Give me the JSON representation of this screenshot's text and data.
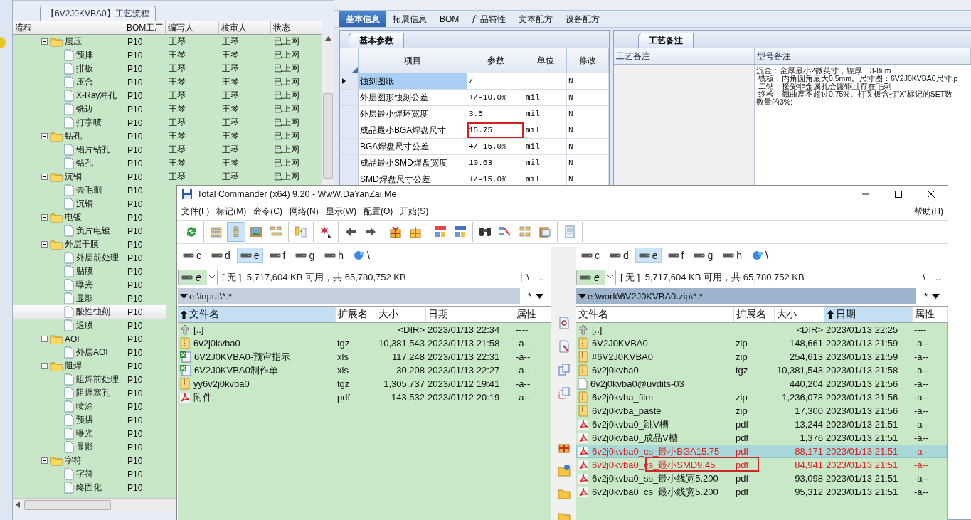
{
  "process_panel": {
    "tab": "【6V2J0KVBA0】工艺流程",
    "columns": [
      "流程",
      "BOM工厂",
      "编写人",
      "核审人",
      "状态"
    ],
    "tree": [
      {
        "name": "层压",
        "bom": "P10",
        "writer": "王琴",
        "reviewer": "王琴",
        "status": "已上网",
        "expanded": true,
        "selected": false,
        "children": [
          {
            "name": "预排",
            "bom": "P10",
            "writer": "王琴",
            "reviewer": "王琴",
            "status": "已上网",
            "selected": false
          },
          {
            "name": "排板",
            "bom": "P10",
            "writer": "王琴",
            "reviewer": "王琴",
            "status": "已上网",
            "selected": false
          },
          {
            "name": "压合",
            "bom": "P10",
            "writer": "王琴",
            "reviewer": "王琴",
            "status": "已上网",
            "selected": false
          },
          {
            "name": "X-Ray冲孔",
            "bom": "P10",
            "writer": "王琴",
            "reviewer": "王琴",
            "status": "已上网",
            "selected": false
          },
          {
            "name": "铣边",
            "bom": "P10",
            "writer": "王琴",
            "reviewer": "王琴",
            "status": "已上网",
            "selected": false
          },
          {
            "name": "打字唛",
            "bom": "P10",
            "writer": "王琴",
            "reviewer": "王琴",
            "status": "已上网",
            "selected": false
          }
        ]
      },
      {
        "name": "钻孔",
        "bom": "P10",
        "writer": "王琴",
        "reviewer": "王琴",
        "status": "已上网",
        "expanded": true,
        "selected": false,
        "children": [
          {
            "name": "铝片钻孔",
            "bom": "P10",
            "writer": "王琴",
            "reviewer": "王琴",
            "status": "已上网",
            "selected": false
          },
          {
            "name": "钻孔",
            "bom": "P10",
            "writer": "王琴",
            "reviewer": "王琴",
            "status": "已上网",
            "selected": false
          }
        ]
      },
      {
        "name": "沉铜",
        "bom": "P10",
        "writer": "王琴",
        "reviewer": "王琴",
        "status": "已上网",
        "expanded": true,
        "selected": false,
        "children": [
          {
            "name": "去毛刺",
            "bom": "P10",
            "selected": false
          },
          {
            "name": "沉铜",
            "bom": "P10",
            "selected": false
          }
        ]
      },
      {
        "name": "电镀",
        "bom": "P10",
        "expanded": true,
        "selected": false,
        "children": [
          {
            "name": "负片电镀",
            "bom": "P10",
            "selected": false
          }
        ]
      },
      {
        "name": "外层干膜",
        "bom": "P10",
        "expanded": true,
        "selected": false,
        "children": [
          {
            "name": "外层前处理",
            "bom": "P10",
            "selected": false
          },
          {
            "name": "贴膜",
            "bom": "P10",
            "selected": false
          },
          {
            "name": "曝光",
            "bom": "P10",
            "selected": false
          },
          {
            "name": "显影",
            "bom": "P10",
            "selected": false
          },
          {
            "name": "酸性蚀刻",
            "bom": "P10",
            "selected": true
          },
          {
            "name": "退膜",
            "bom": "P10",
            "selected": false
          }
        ]
      },
      {
        "name": "AOI",
        "bom": "P10",
        "expanded": true,
        "selected": false,
        "children": [
          {
            "name": "外层AOI",
            "bom": "P10",
            "selected": false
          }
        ]
      },
      {
        "name": "阻焊",
        "bom": "P10",
        "expanded": true,
        "selected": false,
        "children": [
          {
            "name": "阻焊前处理",
            "bom": "P10",
            "selected": false
          },
          {
            "name": "阻焊塞孔",
            "bom": "P10",
            "selected": false
          },
          {
            "name": "喷涂",
            "bom": "P10",
            "selected": false
          },
          {
            "name": "预烘",
            "bom": "P10",
            "selected": false
          },
          {
            "name": "曝光",
            "bom": "P10",
            "selected": false
          },
          {
            "name": "显影",
            "bom": "P10",
            "selected": false
          }
        ]
      },
      {
        "name": "字符",
        "bom": "P10",
        "expanded": true,
        "selected": false,
        "children": [
          {
            "name": "字符",
            "bom": "P10",
            "selected": false
          },
          {
            "name": "终固化",
            "bom": "P10",
            "selected": false
          }
        ]
      }
    ]
  },
  "detail_panel": {
    "tabs": [
      {
        "label": "基本信息",
        "selected": true
      },
      {
        "label": "拓展信息",
        "selected": false
      },
      {
        "label": "BOM",
        "selected": false
      },
      {
        "label": "产品特性",
        "selected": false
      },
      {
        "label": "文本配方",
        "selected": false
      },
      {
        "label": "设备配方",
        "selected": false
      }
    ],
    "params": {
      "tab": "基本参数",
      "columns": [
        "项目",
        "参数",
        "单位",
        "修改"
      ],
      "rows": [
        {
          "item": "蚀刻图纸",
          "value": "/",
          "modified": "N",
          "selected": true,
          "highlighted": false
        },
        {
          "item": "外层图形蚀刻公差",
          "value": "+/-10.0%",
          "unit": "mil",
          "modified": "N",
          "selected": false,
          "highlighted": false
        },
        {
          "item": "外层最小焊环宽度",
          "value": "3.5",
          "unit": "mil",
          "modified": "N",
          "selected": false,
          "highlighted": false
        },
        {
          "item": "成品最小BGA焊盘尺寸",
          "value": "15.75",
          "unit": "mil",
          "modified": "N",
          "selected": false,
          "highlighted": true
        },
        {
          "item": "BGA焊盘尺寸公差",
          "value": "+/-15.0%",
          "unit": "mil",
          "modified": "N",
          "selected": false,
          "highlighted": false
        },
        {
          "item": "成品最小SMD焊盘宽度",
          "value": "10.63",
          "unit": "mil",
          "modified": "N",
          "selected": false,
          "highlighted": false
        },
        {
          "item": "SMD焊盘尺寸公差",
          "value": "+/-15.0%",
          "unit": "mil",
          "modified": "N",
          "selected": false,
          "highlighted": false
        }
      ]
    },
    "notes": {
      "tab": "工艺备注",
      "columns": [
        "工艺备注",
        "型号备注"
      ],
      "lines": [
        "沉金：金厚最小2微英寸，镍厚：3-8um",
        " 铣板：内角圆角最大0.5mm。尺寸图：6V2J0KVBA0尺寸.p",
        " 二钻：接受非金属孔会露铜且存在毛刺",
        " 终检：翘曲度不超过0.75%。打叉板含打“X”标记的SET数",
        "数量的3%;"
      ]
    }
  },
  "commander": {
    "title": "Total Commander (x64) 9.20 - WwW.DaYanZai.Me",
    "menu": [
      "文件(F)",
      "标记(M)",
      "命令(C)",
      "网络(N)",
      "显示(W)",
      "配置(O)",
      "开始(S)"
    ],
    "help": "帮助(H)",
    "toolbar": [
      [
        {
          "kind": "refresh",
          "selected": false
        }
      ],
      [
        {
          "kind": "brief",
          "selected": false
        },
        {
          "kind": "full",
          "selected": true
        },
        {
          "kind": "thumbs",
          "selected": false
        },
        {
          "kind": "tree",
          "selected": false
        }
      ],
      [
        {
          "kind": "compare",
          "selected": false
        }
      ],
      [
        {
          "kind": "star",
          "selected": false
        }
      ],
      [
        {
          "kind": "back",
          "selected": false
        },
        {
          "kind": "forward",
          "selected": false
        }
      ],
      [
        {
          "kind": "pack",
          "selected": false
        },
        {
          "kind": "unpack",
          "selected": false
        }
      ],
      [
        {
          "kind": "ftp",
          "selected": false
        },
        {
          "kind": "url",
          "selected": false
        }
      ],
      [
        {
          "kind": "search",
          "selected": false
        },
        {
          "kind": "rename",
          "selected": false
        },
        {
          "kind": "sync",
          "selected": false
        },
        {
          "kind": "clipboard",
          "selected": false
        }
      ],
      [
        {
          "kind": "notepad",
          "selected": false
        }
      ]
    ],
    "panels": [
      {
        "drives": [
          {
            "letter": "c",
            "selected": false
          },
          {
            "letter": "d",
            "selected": false
          },
          {
            "letter": "e",
            "selected": true
          },
          {
            "letter": "f",
            "selected": false
          },
          {
            "letter": "g",
            "selected": false
          },
          {
            "letter": "h",
            "selected": false
          }
        ],
        "network": "\\",
        "drive": "e",
        "space": "[ 无 ]  5,717,604 KB 可用，共 65,780,752 KB",
        "root_button": "\\",
        "up_button": "..",
        "path": "e:\\input\\*.*",
        "active": false,
        "filter": "*",
        "columns": [
          {
            "label": "文件名",
            "sorted": true
          },
          {
            "label": "扩展名",
            "sorted": false
          },
          {
            "label": "大小",
            "sorted": false
          },
          {
            "label": "日期",
            "sorted": false
          },
          {
            "label": "属性",
            "sorted": false
          }
        ],
        "files": [
          {
            "kind": "up",
            "name": "[..]",
            "size": "<DIR>",
            "date": "2023/01/13 22:34",
            "attr": "----",
            "marked": false,
            "selected": false,
            "framed": false
          },
          {
            "kind": "archive",
            "name": "6v2j0kvba0",
            "ext": "tgz",
            "size": "10,381,543",
            "date": "2023/01/13 21:58",
            "attr": "-a--",
            "marked": false,
            "selected": false,
            "framed": false
          },
          {
            "kind": "excel",
            "name": "6V2J0KVBA0-预审指示",
            "ext": "xls",
            "size": "117,248",
            "date": "2023/01/13 22:31",
            "attr": "-a--",
            "marked": false,
            "selected": false,
            "framed": false
          },
          {
            "kind": "excel",
            "name": "6V2J0KVBA0制作单",
            "ext": "xls",
            "size": "30,208",
            "date": "2023/01/13 22:27",
            "attr": "-a--",
            "marked": false,
            "selected": false,
            "framed": false
          },
          {
            "kind": "archive",
            "name": "yy6v2j0kvba0",
            "ext": "tgz",
            "size": "1,305,737",
            "date": "2023/01/12 19:41",
            "attr": "-a--",
            "marked": false,
            "selected": false,
            "framed": false
          },
          {
            "kind": "pdf",
            "name": "附件",
            "ext": "pdf",
            "size": "143,532",
            "date": "2023/01/12 20:19",
            "attr": "-a--",
            "marked": false,
            "selected": false,
            "framed": false
          }
        ]
      },
      {
        "drives": [
          {
            "letter": "c",
            "selected": false
          },
          {
            "letter": "d",
            "selected": false
          },
          {
            "letter": "e",
            "selected": true
          },
          {
            "letter": "f",
            "selected": false
          },
          {
            "letter": "g",
            "selected": false
          },
          {
            "letter": "h",
            "selected": false
          }
        ],
        "network": "\\",
        "drive": "e",
        "space": "[ 无 ]  5,717,604 KB 可用，共 65,780,752 KB",
        "root_button": "\\",
        "up_button": "..",
        "path": "e:\\work\\6V2J0KVBA0.zip\\*.*",
        "active": true,
        "filter": "*",
        "columns": [
          {
            "label": "文件名",
            "sorted": false
          },
          {
            "label": "扩展名",
            "sorted": false
          },
          {
            "label": "大小",
            "sorted": false
          },
          {
            "label": "日期",
            "sorted": true
          },
          {
            "label": "属性",
            "sorted": false
          }
        ],
        "files": [
          {
            "kind": "up",
            "name": "[..]",
            "size": "<DIR>",
            "date": "2023/01/13 22:25",
            "attr": "----",
            "marked": false,
            "selected": false,
            "framed": false
          },
          {
            "kind": "archive",
            "name": "6V2J0KVBA0",
            "ext": "zip",
            "size": "148,661",
            "date": "2023/01/13 21:59",
            "attr": "-a--",
            "marked": false,
            "selected": false,
            "framed": false
          },
          {
            "kind": "archive",
            "name": "#6V2J0KVBA0",
            "ext": "zip",
            "size": "254,613",
            "date": "2023/01/13 21:59",
            "attr": "-a--",
            "marked": false,
            "selected": false,
            "framed": false
          },
          {
            "kind": "archive",
            "name": "6v2j0kvba0",
            "ext": "tgz",
            "size": "10,381,543",
            "date": "2023/01/13 21:58",
            "attr": "-a--",
            "marked": false,
            "selected": false,
            "framed": false
          },
          {
            "kind": "blank",
            "name": "6v2j0kvba0@uvdits-03",
            "size": "440,204",
            "date": "2023/01/13 21:56",
            "attr": "-a--",
            "marked": false,
            "selected": false,
            "framed": false
          },
          {
            "kind": "archive",
            "name": "6v2j0kvba_film",
            "ext": "zip",
            "size": "1,236,078",
            "date": "2023/01/13 21:56",
            "attr": "-a--",
            "marked": false,
            "selected": false,
            "framed": false
          },
          {
            "kind": "archive",
            "name": "6v2j0kvba_paste",
            "ext": "zip",
            "size": "17,300",
            "date": "2023/01/13 21:56",
            "attr": "-a--",
            "marked": false,
            "selected": false,
            "framed": false
          },
          {
            "kind": "pdf",
            "name": "6v2j0kvba0_跳V槽",
            "ext": "pdf",
            "size": "13,244",
            "date": "2023/01/13 21:51",
            "attr": "-a--",
            "marked": false,
            "selected": false,
            "framed": false
          },
          {
            "kind": "pdf",
            "name": "6v2j0kvba0_成品V槽",
            "ext": "pdf",
            "size": "1,376",
            "date": "2023/01/13 21:51",
            "attr": "-a--",
            "marked": false,
            "selected": false,
            "framed": false
          },
          {
            "kind": "pdf",
            "name": "6v2j0kvba0_cs_最小BGA15.75",
            "ext": "pdf",
            "size": "88,171",
            "date": "2023/01/13 21:51",
            "attr": "-a--",
            "marked": true,
            "selected": true,
            "framed": false
          },
          {
            "kind": "pdf",
            "name": "6v2j0kvba0_cs_最小SMD9.45",
            "ext": "pdf",
            "size": "84,941",
            "date": "2023/01/13 21:51",
            "attr": "-a--",
            "marked": true,
            "selected": false,
            "framed": true
          },
          {
            "kind": "pdf",
            "name": "6v2j0kvba0_ss_最小线宽5.200",
            "ext": "pdf",
            "size": "93,098",
            "date": "2023/01/13 21:51",
            "attr": "-a--",
            "marked": false,
            "selected": false,
            "framed": false
          },
          {
            "kind": "pdf",
            "name": "6v2j0kvba0_cs_最小线宽5.200",
            "ext": "pdf",
            "size": "95,312",
            "date": "2023/01/13 21:51",
            "attr": "-a--",
            "marked": false,
            "selected": false,
            "framed": false
          }
        ]
      }
    ]
  }
}
